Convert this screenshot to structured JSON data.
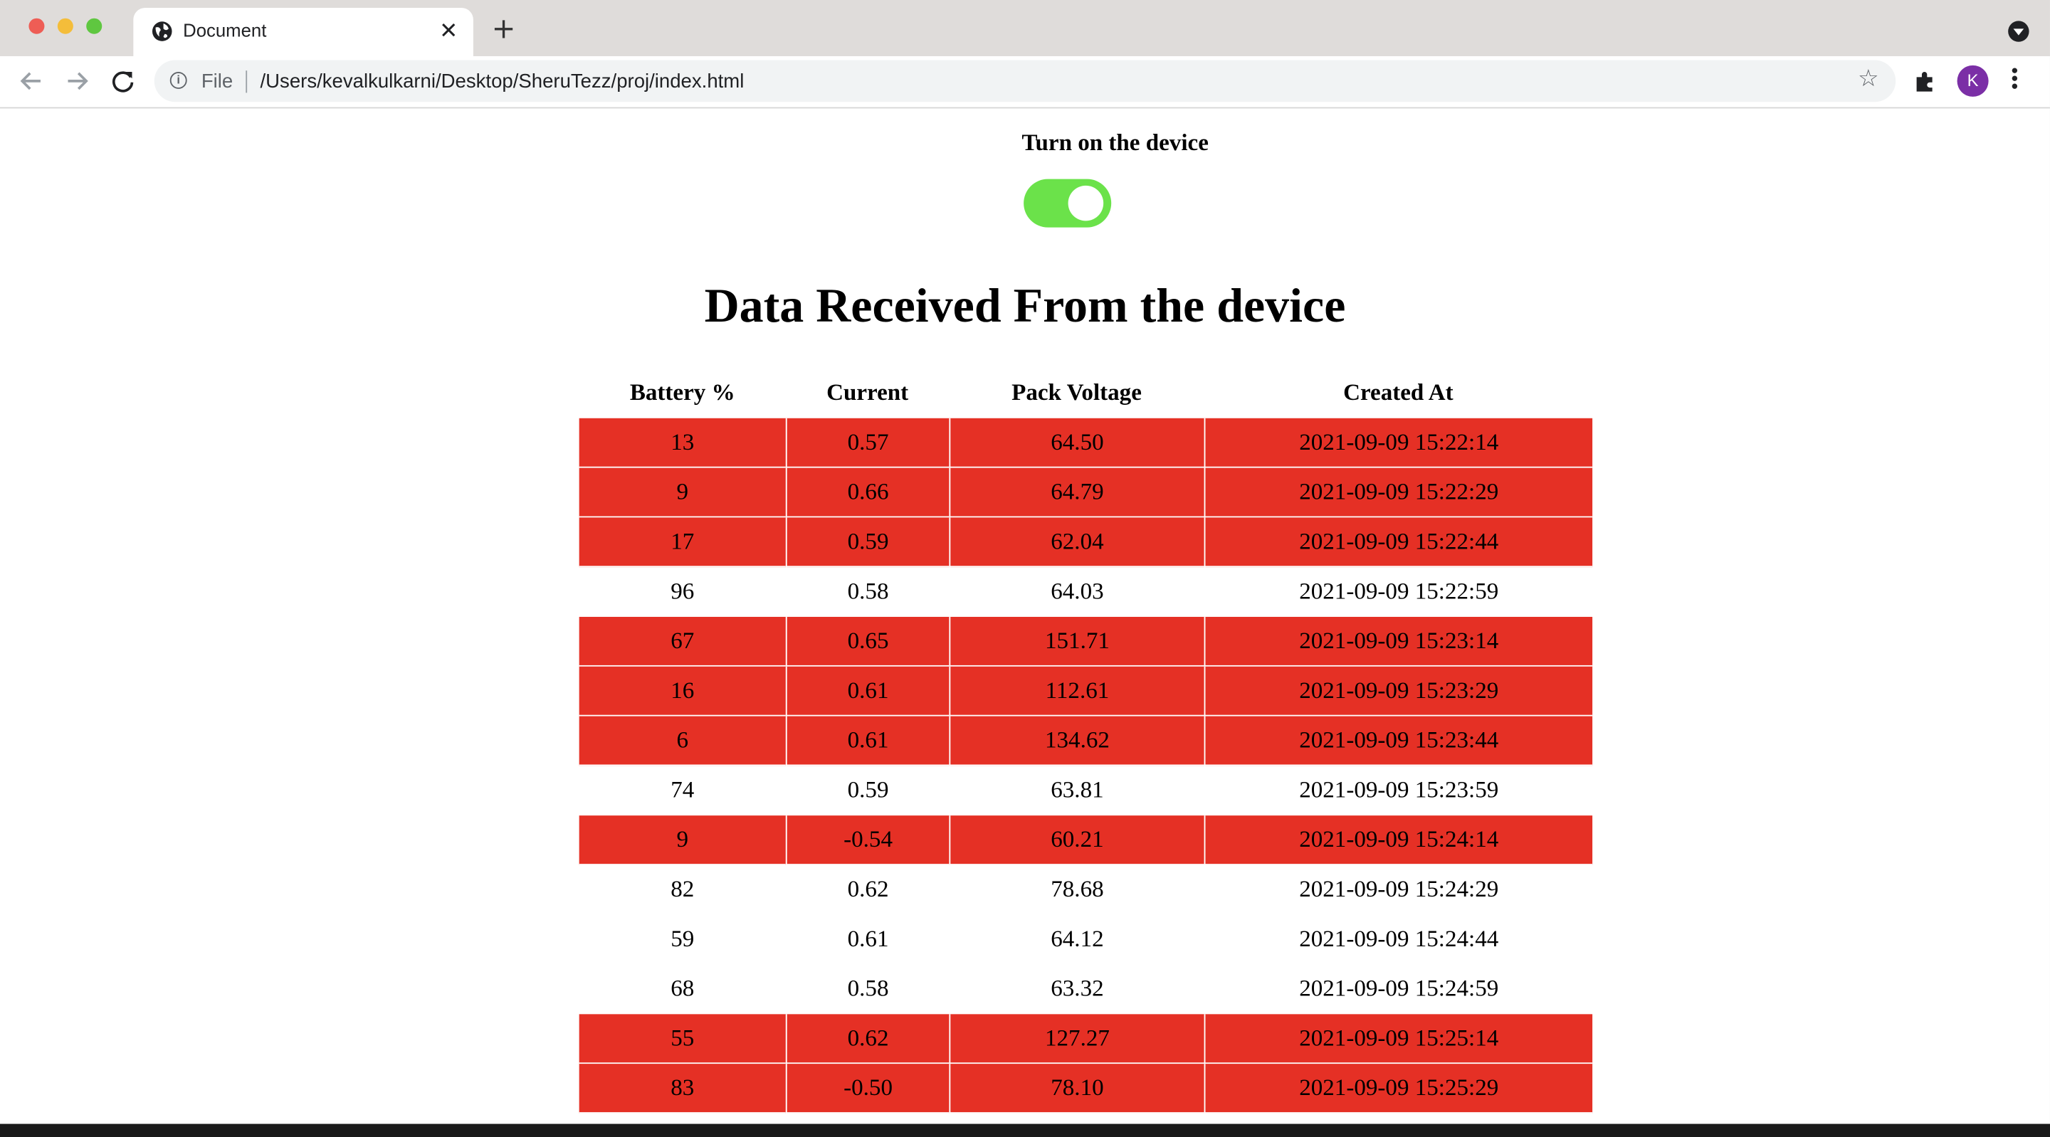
{
  "browser": {
    "tab_title": "Document",
    "tab_close": "✕",
    "new_tab": "+",
    "url_scheme": "File",
    "url": "/Users/kevalkulkarni/Desktop/SheruTezz/proj/index.html",
    "avatar_letter": "K",
    "traffic_lights": [
      "#ee5d55",
      "#f4bd3a",
      "#5fc740"
    ]
  },
  "page": {
    "toggle_label": "Turn on the device",
    "toggle_on": true,
    "toggle_color": "#6be24a",
    "heading": "Data Received From the device",
    "alert_color": "#e53025",
    "table": {
      "headers": [
        "Battery %",
        "Current",
        "Pack Voltage",
        "Created At"
      ],
      "rows": [
        {
          "battery": "13",
          "current": "0.57",
          "voltage": "64.50",
          "created": "2021-09-09 15:22:14",
          "alert": true
        },
        {
          "battery": "9",
          "current": "0.66",
          "voltage": "64.79",
          "created": "2021-09-09 15:22:29",
          "alert": true
        },
        {
          "battery": "17",
          "current": "0.59",
          "voltage": "62.04",
          "created": "2021-09-09 15:22:44",
          "alert": true
        },
        {
          "battery": "96",
          "current": "0.58",
          "voltage": "64.03",
          "created": "2021-09-09 15:22:59",
          "alert": false
        },
        {
          "battery": "67",
          "current": "0.65",
          "voltage": "151.71",
          "created": "2021-09-09 15:23:14",
          "alert": true
        },
        {
          "battery": "16",
          "current": "0.61",
          "voltage": "112.61",
          "created": "2021-09-09 15:23:29",
          "alert": true
        },
        {
          "battery": "6",
          "current": "0.61",
          "voltage": "134.62",
          "created": "2021-09-09 15:23:44",
          "alert": true
        },
        {
          "battery": "74",
          "current": "0.59",
          "voltage": "63.81",
          "created": "2021-09-09 15:23:59",
          "alert": false
        },
        {
          "battery": "9",
          "current": "-0.54",
          "voltage": "60.21",
          "created": "2021-09-09 15:24:14",
          "alert": true
        },
        {
          "battery": "82",
          "current": "0.62",
          "voltage": "78.68",
          "created": "2021-09-09 15:24:29",
          "alert": false
        },
        {
          "battery": "59",
          "current": "0.61",
          "voltage": "64.12",
          "created": "2021-09-09 15:24:44",
          "alert": false
        },
        {
          "battery": "68",
          "current": "0.58",
          "voltage": "63.32",
          "created": "2021-09-09 15:24:59",
          "alert": false
        },
        {
          "battery": "55",
          "current": "0.62",
          "voltage": "127.27",
          "created": "2021-09-09 15:25:14",
          "alert": true
        },
        {
          "battery": "83",
          "current": "-0.50",
          "voltage": "78.10",
          "created": "2021-09-09 15:25:29",
          "alert": true
        }
      ]
    }
  }
}
